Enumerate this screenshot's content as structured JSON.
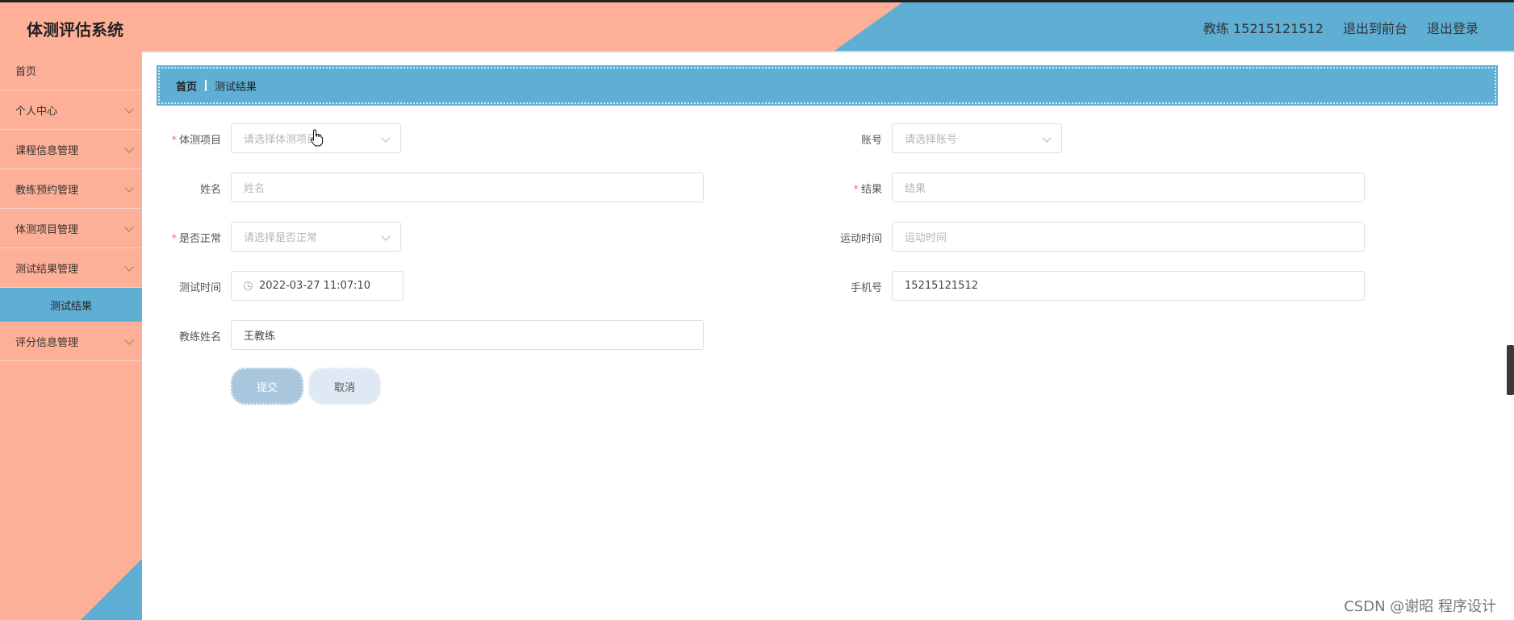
{
  "app": {
    "title": "体测评估系统"
  },
  "header": {
    "user": "教练 15215121512",
    "to_frontend": "退出到前台",
    "logout": "退出登录"
  },
  "colors": {
    "salmon": "#fdb097",
    "blue": "#5faed4",
    "required": "#f56c6c"
  },
  "sidebar": {
    "items": [
      {
        "label": "首页"
      },
      {
        "label": "个人中心"
      },
      {
        "label": "课程信息管理"
      },
      {
        "label": "教练预约管理"
      },
      {
        "label": "体测项目管理"
      },
      {
        "label": "测试结果管理"
      },
      {
        "label": "测试结果"
      },
      {
        "label": "评分信息管理"
      }
    ]
  },
  "breadcrumb": {
    "home": "首页",
    "current": "测试结果"
  },
  "form": {
    "project": {
      "label": "体测项目",
      "placeholder": "请选择体测项目"
    },
    "account": {
      "label": "账号",
      "placeholder": "请选择账号"
    },
    "name": {
      "label": "姓名",
      "placeholder": "姓名"
    },
    "result": {
      "label": "结果",
      "placeholder": "结果"
    },
    "normal": {
      "label": "是否正常",
      "placeholder": "请选择是否正常"
    },
    "exercise_time": {
      "label": "运动时间",
      "placeholder": "运动时间"
    },
    "test_time": {
      "label": "测试时间",
      "value": "2022-03-27 11:07:10"
    },
    "phone": {
      "label": "手机号",
      "value": "15215121512"
    },
    "coach_name": {
      "label": "教练姓名",
      "value": "王教练"
    },
    "required_mark": "*",
    "submit": "提交",
    "cancel": "取消"
  },
  "watermark": "CSDN @谢昭  程序设计"
}
